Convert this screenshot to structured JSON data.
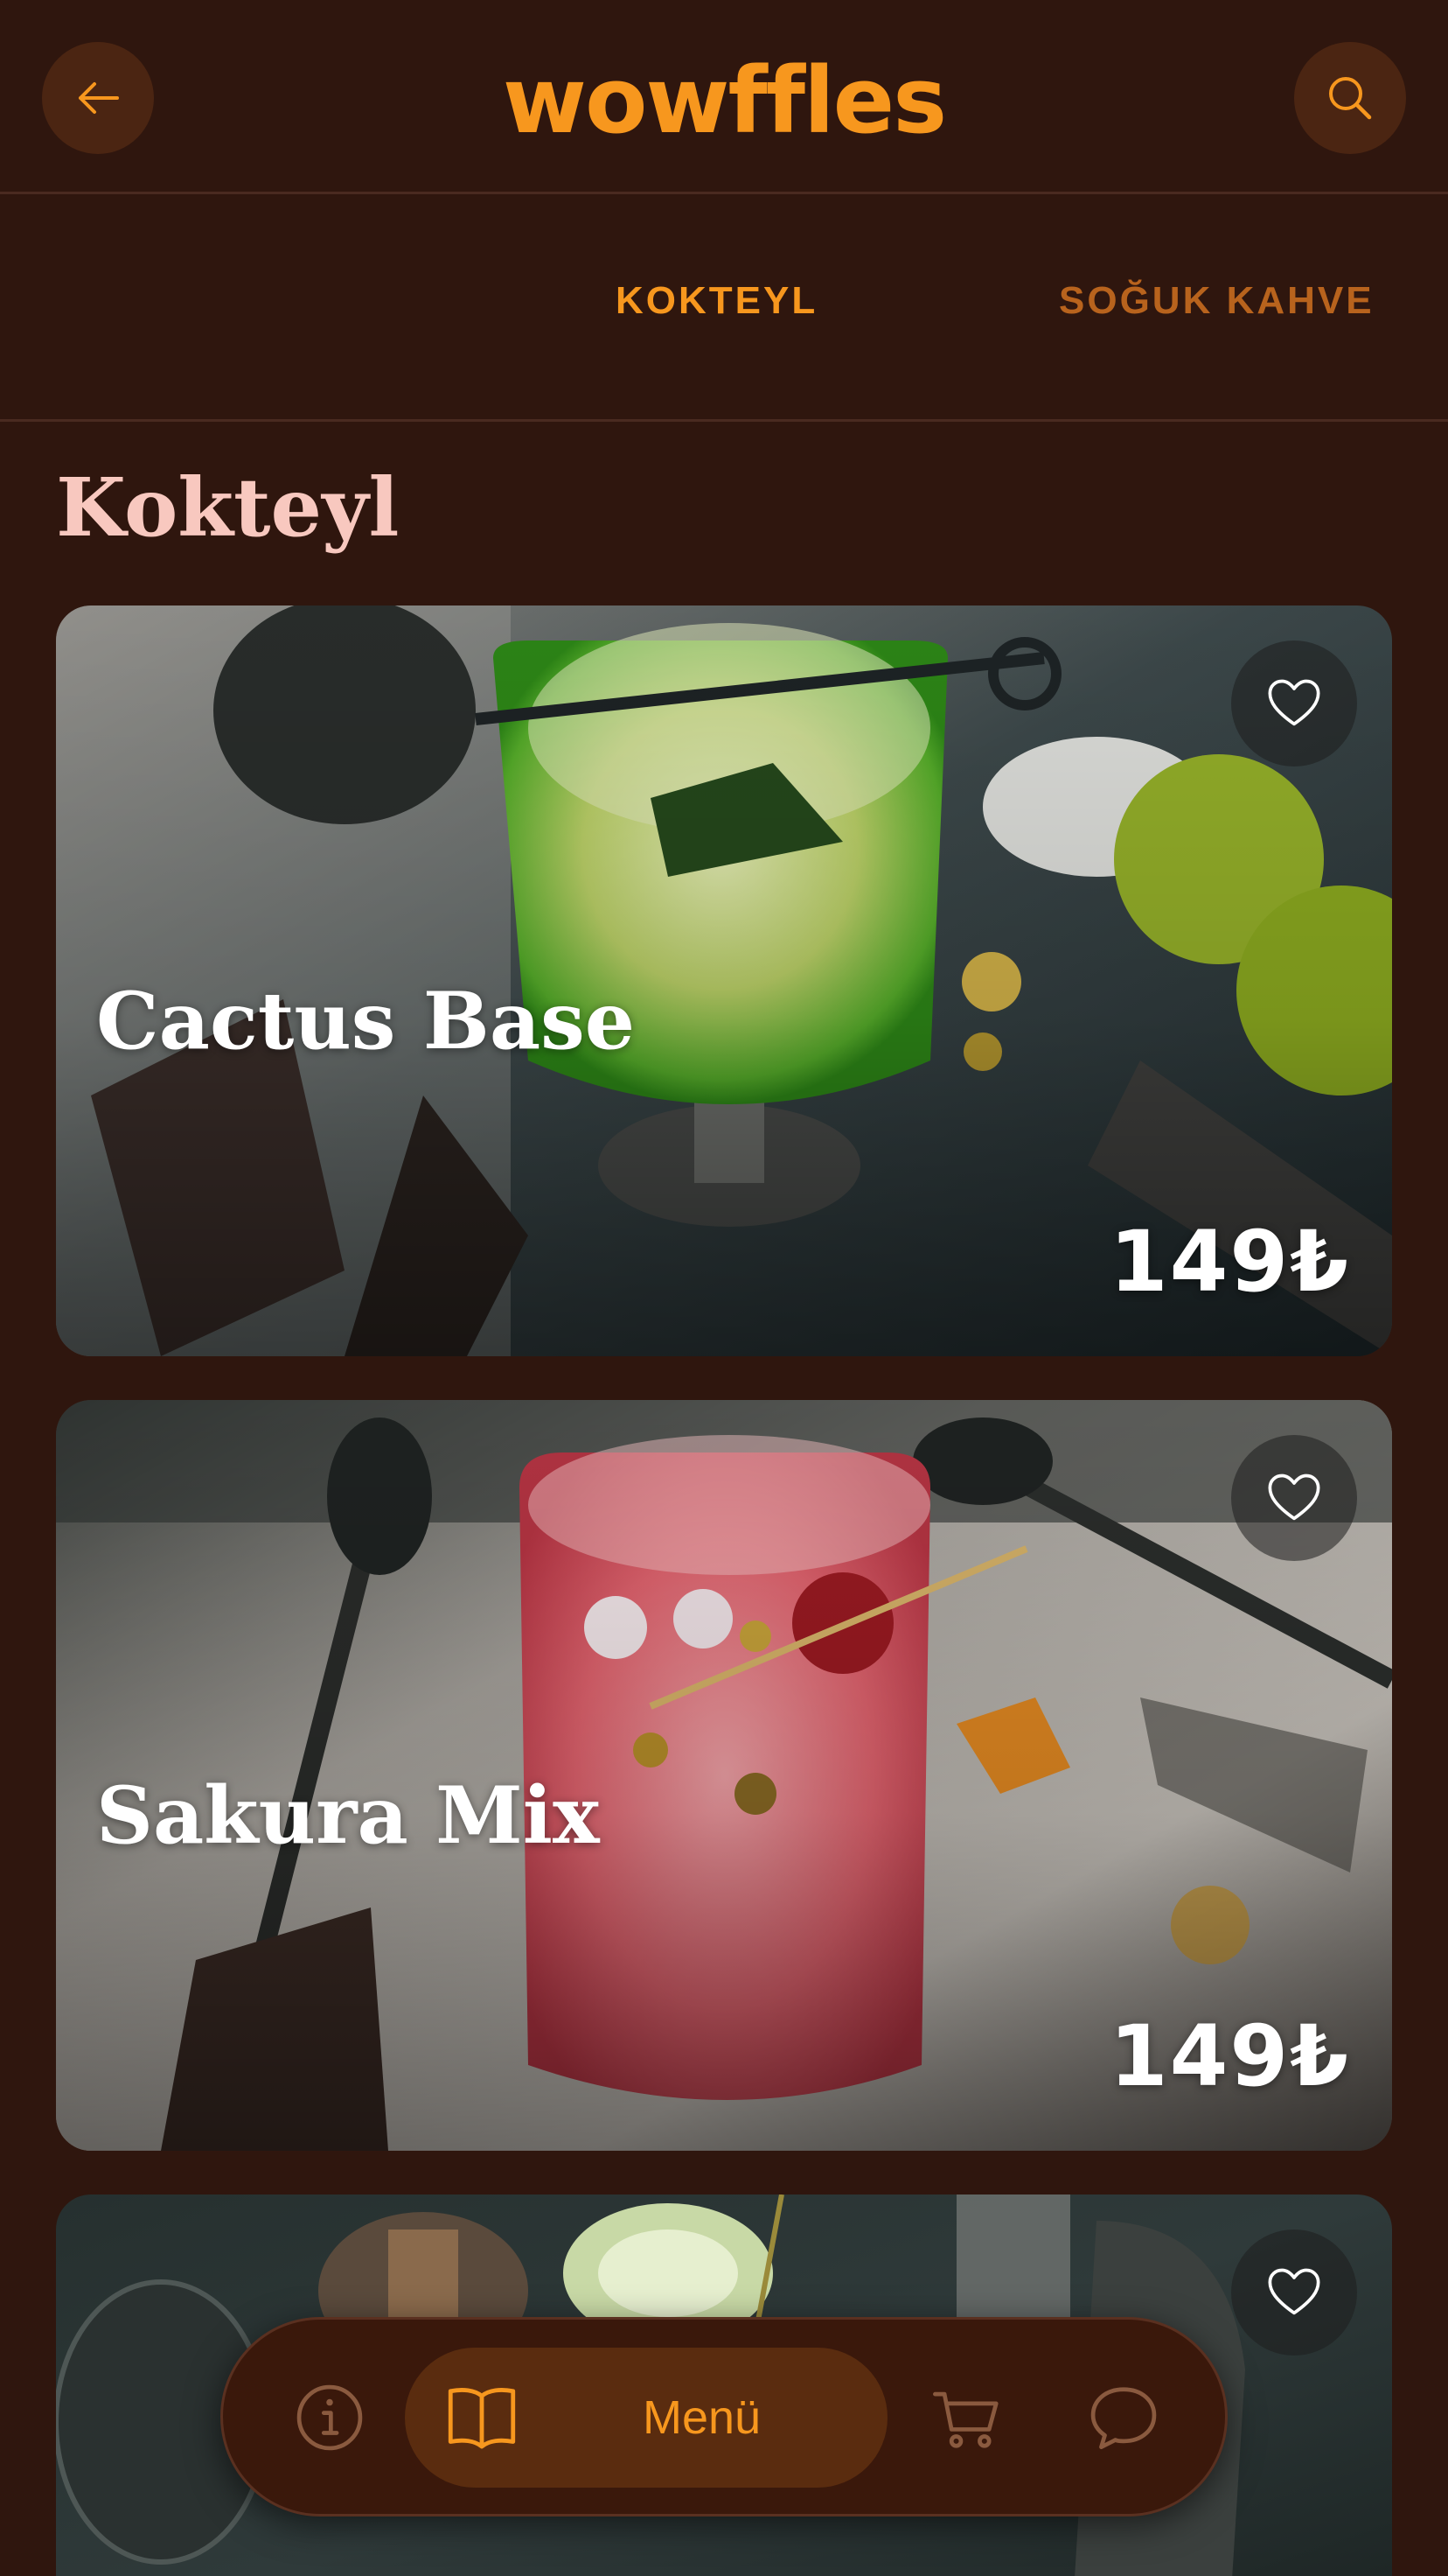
{
  "header": {
    "logo": "wowffles",
    "back_icon": "arrow-left-icon",
    "search_icon": "search-icon"
  },
  "tabs": [
    {
      "label": "KOKTEYL",
      "active": true
    },
    {
      "label": "SOĞUK KAHVE",
      "active": false
    }
  ],
  "section": {
    "title": "Kokteyl"
  },
  "products": [
    {
      "name": "Cactus Base",
      "price": "149₺",
      "favorite_icon": "heart-icon"
    },
    {
      "name": "Sakura Mix",
      "price": "149₺",
      "favorite_icon": "heart-icon"
    },
    {
      "name": "",
      "price": "",
      "favorite_icon": "heart-icon"
    }
  ],
  "bottom_nav": {
    "items": [
      {
        "icon": "info-icon",
        "label": ""
      },
      {
        "icon": "book-icon",
        "label": "Menü",
        "active": true
      },
      {
        "icon": "cart-icon",
        "label": ""
      },
      {
        "icon": "chat-icon",
        "label": ""
      }
    ]
  },
  "colors": {
    "background": "#2f160e",
    "accent": "#f7971e",
    "accent_dim": "#b8631d",
    "section_title": "#f8c8bf",
    "pill": "#5a2c0f"
  }
}
